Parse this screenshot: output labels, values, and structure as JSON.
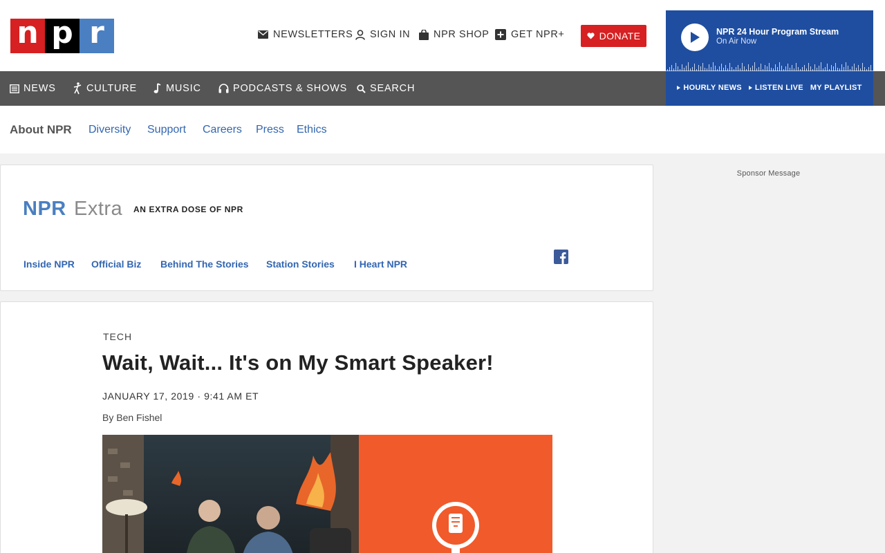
{
  "logo": {
    "letters": [
      "n",
      "p",
      "r"
    ]
  },
  "header": {
    "newsletters": "NEWSLETTERS",
    "sign_in": "SIGN IN",
    "npr_shop": "NPR SHOP",
    "get_npr_plus": "GET NPR+",
    "donate": "DONATE"
  },
  "player": {
    "title": "NPR 24 Hour Program Stream",
    "subtitle": "On Air Now",
    "links": [
      "HOURLY NEWS",
      "LISTEN LIVE",
      "MY PLAYLIST"
    ]
  },
  "nav": {
    "news": "NEWS",
    "culture": "CULTURE",
    "music": "MUSIC",
    "podcasts": "PODCASTS & SHOWS",
    "search": "SEARCH"
  },
  "subnav": {
    "title": "About NPR",
    "items": [
      "Diversity",
      "Support",
      "Careers",
      "Press",
      "Ethics"
    ]
  },
  "brand": {
    "npr": "NPR",
    "extra": "Extra",
    "tagline": "AN EXTRA DOSE OF NPR",
    "links": [
      "Inside NPR",
      "Official Biz",
      "Behind The Stories",
      "Station Stories",
      "I Heart NPR"
    ]
  },
  "article": {
    "slug": "TECH",
    "headline": "Wait, Wait... It's on My Smart Speaker!",
    "dateline": "JANUARY 17, 2019 · 9:41 AM ET",
    "byline": "By Ben Fishel"
  },
  "sponsor": "Sponsor Message",
  "colors": {
    "npr_red": "#d62021",
    "npr_blue": "#4a7fc1",
    "player_blue": "#1f4ea0",
    "link_blue": "#3266b1",
    "nav_gray": "#555555",
    "photo_orange": "#f15a2b"
  }
}
